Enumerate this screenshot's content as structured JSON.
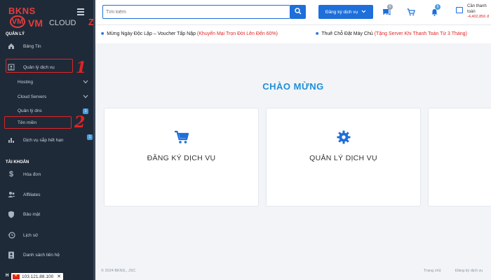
{
  "logo": {
    "brand": "BKNS",
    "badge": "VM",
    "vm": "VM",
    "cloud": "CLOUD",
    "suffix": "Z"
  },
  "sidebar": {
    "section_manage": "QUẢN LÝ",
    "section_account": "TÀI KHOẢN",
    "items": {
      "dashboard": "Bảng Tin",
      "services": "Quản lý dịch vụ",
      "hosting": "Hosting",
      "cloud_servers": "Cloud Servers",
      "dns": "Quản lý dns",
      "domains": "Tên miền",
      "expiring": "Dịch vụ sắp hết hạn",
      "invoices": "Hóa đơn",
      "affiliates": "Affiliates",
      "security": "Bảo mật",
      "history": "Lịch sử",
      "contacts": "Danh sách liên hệ"
    },
    "badges": {
      "dns": "1",
      "expiring": "1"
    },
    "bottom_partial": "H"
  },
  "annotations": {
    "one": "1",
    "two": "2"
  },
  "ip_indicator": {
    "ip": "103.121.88.100",
    "close": "✕"
  },
  "topbar": {
    "search_placeholder": "Tìm kiếm",
    "register_button": "Đăng ký dịch vụ",
    "chat_badge": "0",
    "cart_label": "",
    "notify_badge": "6",
    "need_pay_label": "Cần thanh toán",
    "need_pay_amount": "-4,402,856 đ"
  },
  "marquee": [
    {
      "text": "Mừng Ngày Độc Lập – Voucher Tấp Nập ",
      "highlight": "(Khuyến Mại Trọn Đời Lên Đến 60%)"
    },
    {
      "text": "Thuê Chỗ Đặt Máy Chủ ",
      "highlight": "(Tặng Server Khi Thanh Toán Từ 3 Tháng)"
    }
  ],
  "main": {
    "welcome": "CHÀO MỪNG",
    "cards": [
      {
        "label": "ĐĂNG KÝ DỊCH VỤ",
        "icon": "cart-icon"
      },
      {
        "label": "QUẢN LÝ DỊCH VỤ",
        "icon": "gear-icon"
      }
    ]
  },
  "footer": {
    "copyright": "© 2024 BKNS., JSC",
    "home": "Trang chủ",
    "register": "Đăng ký dịch vụ"
  },
  "colors": {
    "sidebar": "#1f2a38",
    "accent": "#1e6fd9",
    "title": "#1e8fd9",
    "alert": "#e02424"
  }
}
